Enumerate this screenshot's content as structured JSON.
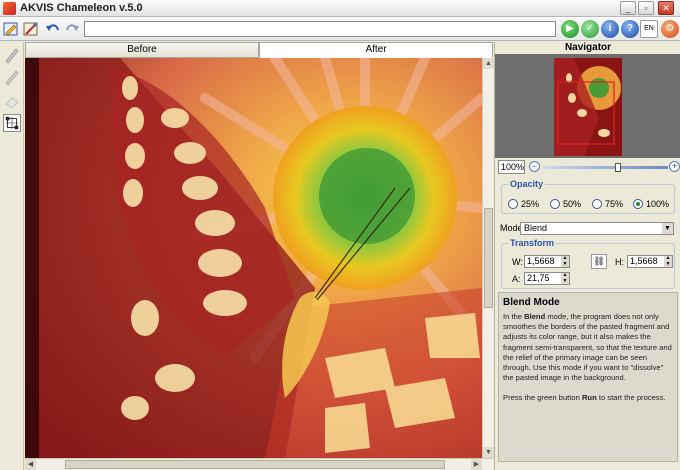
{
  "window": {
    "title": "AKVIS Chameleon v.5.0"
  },
  "toolbar": {
    "path_value": "",
    "lang_label": "EN"
  },
  "tabs": [
    {
      "label": "Before",
      "active": false
    },
    {
      "label": "After",
      "active": true
    }
  ],
  "navigator": {
    "header": "Navigator",
    "zoom_value": "100%",
    "zoom_level_fraction": 0.6
  },
  "opacity": {
    "title": "Opacity",
    "options": [
      "25%",
      "50%",
      "75%",
      "100%"
    ],
    "selected": "100%"
  },
  "mode": {
    "label": "Mode",
    "value": "Blend"
  },
  "transform": {
    "title": "Transform",
    "w_label": "W:",
    "w_value": "1,5668",
    "h_label": "H:",
    "h_value": "1,5668",
    "a_label": "A:",
    "a_value": "21,75"
  },
  "help": {
    "title": "Blend Mode",
    "p1_a": "In the ",
    "p1_b": "Blend",
    "p1_c": " mode, the program does not only smoothes the borders of the pasted fragment and adjusts its color range, but it also makes the fragment semi-transparent, so that the texture and the relief of the primary image can be seen through. Use this mode if you want to \"dissolve\" the pasted image in the background.",
    "p2_a": "Press the green button ",
    "p2_b": "Run",
    "p2_c": " to start the process."
  },
  "colors": {
    "accent_blue": "#2a55a8",
    "run_green": "#3aa83a",
    "close_red": "#c43a24"
  }
}
